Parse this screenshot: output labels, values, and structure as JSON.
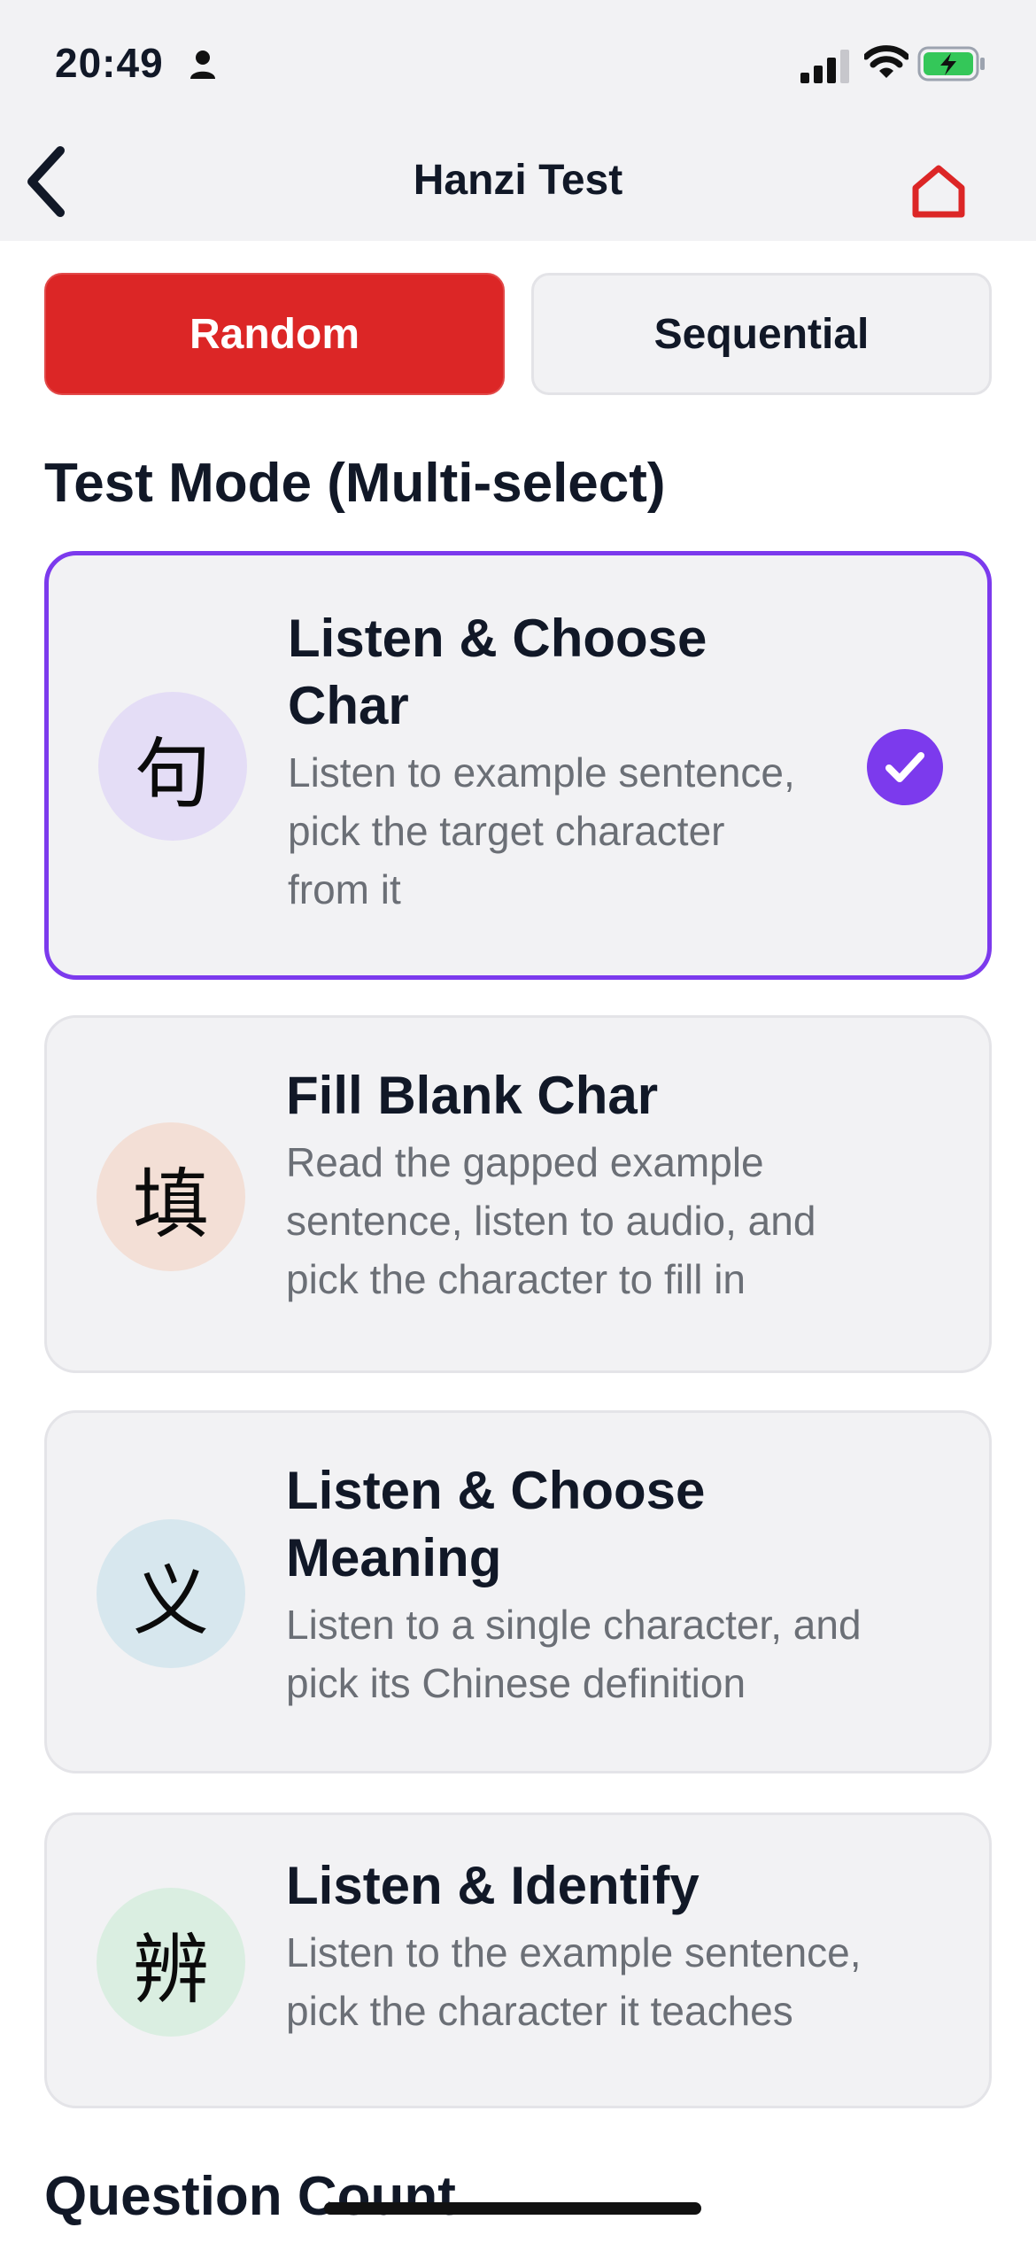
{
  "status_bar": {
    "time": "20:49",
    "icons": [
      "person-icon",
      "cellular-signal-icon",
      "wifi-icon",
      "battery-charging-icon"
    ],
    "battery_color": "#34c759"
  },
  "nav": {
    "title": "Hanzi Test",
    "back_icon": "chevron-left-icon",
    "home_icon": "home-icon",
    "home_color": "#dc2626"
  },
  "order_options": {
    "random_label": "Random",
    "sequential_label": "Sequential",
    "selected": "Random",
    "accent": "#dc2626"
  },
  "test_mode": {
    "section_title": "Test Mode (Multi-select)",
    "accent": "#7c3aed",
    "modes": [
      {
        "icon_char": "句",
        "icon_bg": "#e4ddf6",
        "title_line1": "Listen & Choose",
        "title_line2": "Char",
        "desc_line1": "Listen to example sentence,",
        "desc_line2": "pick the target character",
        "desc_line3": "from it",
        "selected": true
      },
      {
        "icon_char": "填",
        "icon_bg": "#f3dfd6",
        "title_line1": "Fill Blank Char",
        "desc_line1": "Read the gapped example",
        "desc_line2": "sentence, listen to audio, and",
        "desc_line3": "pick the character to fill in",
        "selected": false
      },
      {
        "icon_char": "义",
        "icon_bg": "#d7e7ee",
        "title_line1": "Listen & Choose",
        "title_line2": "Meaning",
        "desc_line1": "Listen to a single character, and",
        "desc_line2": "pick its Chinese definition",
        "selected": false
      },
      {
        "icon_char": "辨",
        "icon_bg": "#daeee1",
        "title_line1": "Listen & Identify",
        "desc_line1": "Listen to the example sentence,",
        "desc_line2": "pick the character it teaches",
        "selected": false
      }
    ]
  },
  "question_count": {
    "section_title": "Question Count"
  }
}
